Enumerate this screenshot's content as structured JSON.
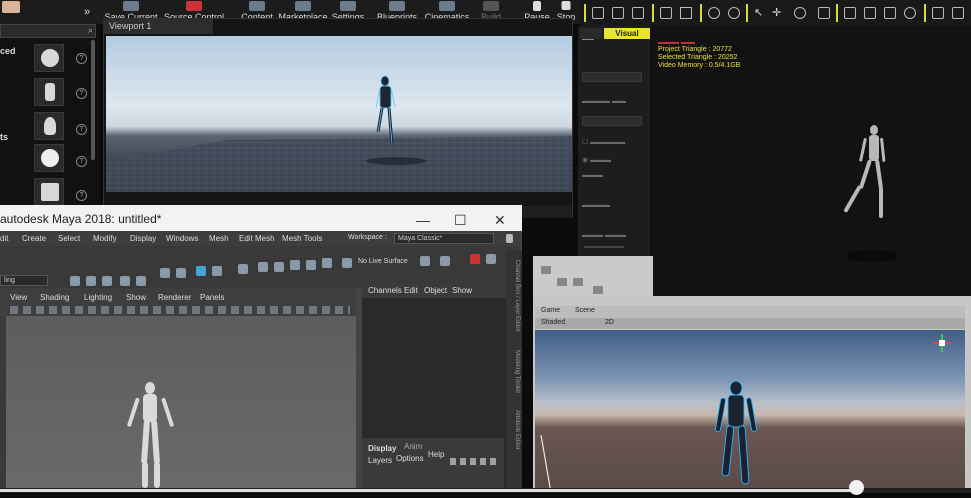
{
  "unreal": {
    "toolbar": [
      "Save Current",
      "Source Control",
      "Content",
      "Marketplace",
      "Settings",
      "Blueprints",
      "Cinematics",
      "Build",
      "Pause",
      "Stop"
    ],
    "left_labels": [
      "ced",
      "ts"
    ],
    "viewport_tab": "Viewport 1",
    "console_prompt": ">",
    "details_tab": "Visual",
    "stats": {
      "line1": "Project Triangle : 20772",
      "line2": "Selected Triangle : 20252",
      "line3": "Video Memory : 0.5/4.1GB"
    }
  },
  "maya": {
    "title": "autodesk Maya 2018: untitled*",
    "window_buttons": [
      "—",
      "☐",
      "✕"
    ],
    "menu": [
      "dit",
      "Create",
      "Select",
      "Modify",
      "Display",
      "Windows",
      "Mesh",
      "Edit Mesh",
      "Mesh Tools"
    ],
    "workspace_label": "Workspace :",
    "workspace_value": "Maya Classic*",
    "live_surface": "No Live Surface",
    "shelf_dropdown": "ling",
    "panel_menu": [
      "View",
      "Shading",
      "Lighting",
      "Show",
      "Renderer",
      "Panels"
    ],
    "channel_menu": [
      "Channels",
      "Edit",
      "Object",
      "Show"
    ],
    "side_tabs": [
      "Channel Box / Layer Editor",
      "Modeling Toolkit",
      "Attribute Editor"
    ],
    "display_tabs": [
      "Display",
      "Anim"
    ],
    "display_menu": [
      "Layers",
      "Options",
      "Help"
    ]
  },
  "unity": {
    "tabs": [
      "Game",
      "Scene"
    ],
    "controls": [
      "Shaded",
      "2D"
    ]
  },
  "video": {
    "progress_fraction": 0.882
  }
}
